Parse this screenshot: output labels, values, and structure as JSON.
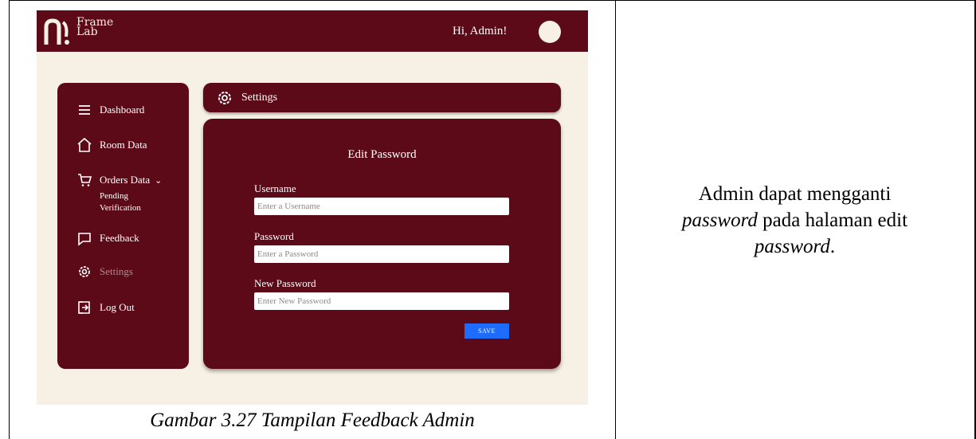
{
  "app": {
    "logo_line1": "Frame",
    "logo_line2": "Lab",
    "greeting": "Hi, Admin!"
  },
  "sidebar": {
    "items": [
      {
        "label": "Dashboard",
        "icon": "menu-icon"
      },
      {
        "label": "Room Data",
        "icon": "home-icon"
      },
      {
        "label": "Orders Data",
        "icon": "cart-icon",
        "expanded": true
      },
      {
        "label": "Feedback",
        "icon": "chat-icon"
      },
      {
        "label": "Settings",
        "icon": "gear-icon",
        "active": true
      },
      {
        "label": "Log Out",
        "icon": "logout-icon"
      }
    ],
    "orders_sub": [
      "Pending",
      "Verification"
    ]
  },
  "header": {
    "title": "Settings",
    "icon": "gear-icon"
  },
  "form": {
    "title": "Edit Password",
    "username_label": "Username",
    "username_placeholder": "Enter a Username",
    "password_label": "Password",
    "password_placeholder": "Enter a Password",
    "new_password_label": "New Password",
    "new_password_placeholder": "Enter New Password",
    "save_label": "SAVE"
  },
  "document": {
    "caption": "Gambar 3.27 Tampilan Feedback Admin",
    "description_part1": "Admin dapat mengganti",
    "description_em1": "password",
    "description_part2": " pada halaman edit",
    "description_em2": "password",
    "description_part3": "."
  },
  "colors": {
    "brand": "#5c0a18",
    "background": "#f6f1e4",
    "save_button": "#1e6bff",
    "muted_nav": "#b08a8f"
  }
}
